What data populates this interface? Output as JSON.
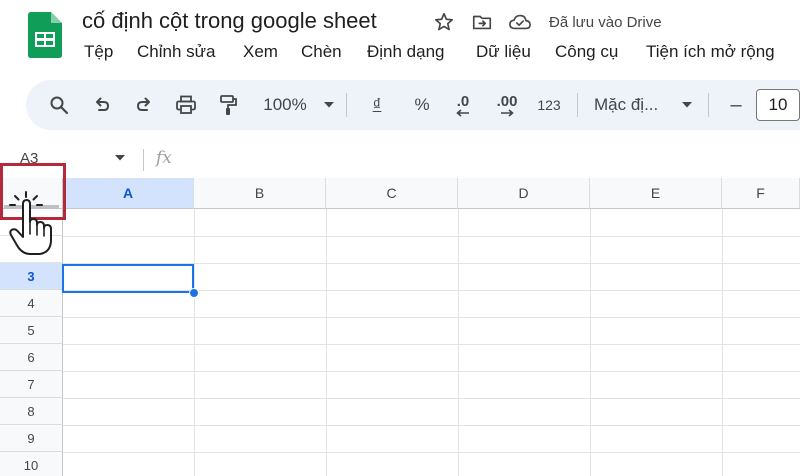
{
  "header": {
    "doc_title": "cố định cột trong google sheet",
    "save_status": "Đã lưu vào Drive",
    "icons": [
      "star-icon",
      "move-to-folder-icon",
      "cloud-saved-icon"
    ]
  },
  "menubar": {
    "items": [
      "Tệp",
      "Chỉnh sửa",
      "Xem",
      "Chèn",
      "Định dạng",
      "Dữ liệu",
      "Công cụ",
      "Tiện ích mở rộng"
    ]
  },
  "toolbar": {
    "zoom": "100%",
    "currency": "₫",
    "percent": "%",
    "decrease_decimal": ".0",
    "increase_decimal": ".00",
    "more_formats": "123",
    "font_family": "Mặc đị...",
    "font_size": "10",
    "decrease_font": "–"
  },
  "formula_bar": {
    "name_box": "A3",
    "fx": "fx"
  },
  "grid": {
    "columns": [
      "A",
      "B",
      "C",
      "D",
      "E",
      "F"
    ],
    "rows": [
      "3",
      "4",
      "5",
      "6",
      "7",
      "8",
      "9",
      "10"
    ],
    "selected_cell": "A3",
    "selected_column": "A",
    "selected_row": "3"
  },
  "colors": {
    "accent": "#1a73e8",
    "selection_header": "#d3e3fd",
    "highlight_frame": "#b52a3a",
    "sheets_green": "#0f9d58"
  }
}
